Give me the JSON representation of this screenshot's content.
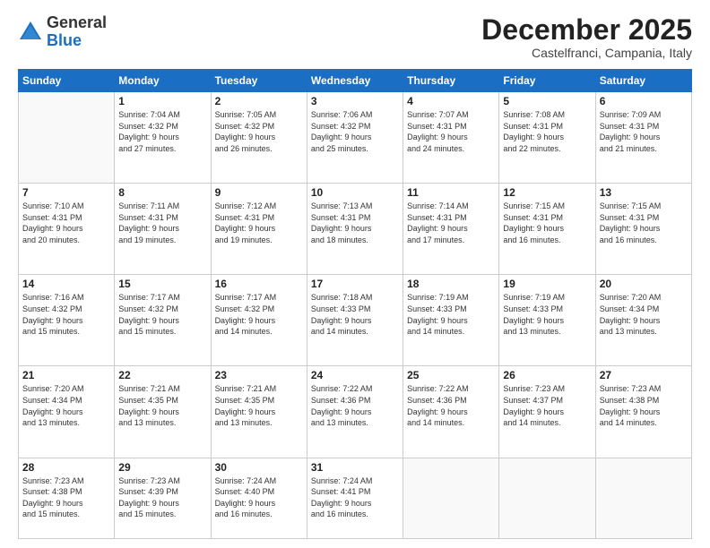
{
  "logo": {
    "general": "General",
    "blue": "Blue"
  },
  "header": {
    "month": "December 2025",
    "location": "Castelfranci, Campania, Italy"
  },
  "days_of_week": [
    "Sunday",
    "Monday",
    "Tuesday",
    "Wednesday",
    "Thursday",
    "Friday",
    "Saturday"
  ],
  "weeks": [
    [
      {
        "day": "",
        "info": ""
      },
      {
        "day": "1",
        "info": "Sunrise: 7:04 AM\nSunset: 4:32 PM\nDaylight: 9 hours\nand 27 minutes."
      },
      {
        "day": "2",
        "info": "Sunrise: 7:05 AM\nSunset: 4:32 PM\nDaylight: 9 hours\nand 26 minutes."
      },
      {
        "day": "3",
        "info": "Sunrise: 7:06 AM\nSunset: 4:32 PM\nDaylight: 9 hours\nand 25 minutes."
      },
      {
        "day": "4",
        "info": "Sunrise: 7:07 AM\nSunset: 4:31 PM\nDaylight: 9 hours\nand 24 minutes."
      },
      {
        "day": "5",
        "info": "Sunrise: 7:08 AM\nSunset: 4:31 PM\nDaylight: 9 hours\nand 22 minutes."
      },
      {
        "day": "6",
        "info": "Sunrise: 7:09 AM\nSunset: 4:31 PM\nDaylight: 9 hours\nand 21 minutes."
      }
    ],
    [
      {
        "day": "7",
        "info": "Sunrise: 7:10 AM\nSunset: 4:31 PM\nDaylight: 9 hours\nand 20 minutes."
      },
      {
        "day": "8",
        "info": "Sunrise: 7:11 AM\nSunset: 4:31 PM\nDaylight: 9 hours\nand 19 minutes."
      },
      {
        "day": "9",
        "info": "Sunrise: 7:12 AM\nSunset: 4:31 PM\nDaylight: 9 hours\nand 19 minutes."
      },
      {
        "day": "10",
        "info": "Sunrise: 7:13 AM\nSunset: 4:31 PM\nDaylight: 9 hours\nand 18 minutes."
      },
      {
        "day": "11",
        "info": "Sunrise: 7:14 AM\nSunset: 4:31 PM\nDaylight: 9 hours\nand 17 minutes."
      },
      {
        "day": "12",
        "info": "Sunrise: 7:15 AM\nSunset: 4:31 PM\nDaylight: 9 hours\nand 16 minutes."
      },
      {
        "day": "13",
        "info": "Sunrise: 7:15 AM\nSunset: 4:31 PM\nDaylight: 9 hours\nand 16 minutes."
      }
    ],
    [
      {
        "day": "14",
        "info": "Sunrise: 7:16 AM\nSunset: 4:32 PM\nDaylight: 9 hours\nand 15 minutes."
      },
      {
        "day": "15",
        "info": "Sunrise: 7:17 AM\nSunset: 4:32 PM\nDaylight: 9 hours\nand 15 minutes."
      },
      {
        "day": "16",
        "info": "Sunrise: 7:17 AM\nSunset: 4:32 PM\nDaylight: 9 hours\nand 14 minutes."
      },
      {
        "day": "17",
        "info": "Sunrise: 7:18 AM\nSunset: 4:33 PM\nDaylight: 9 hours\nand 14 minutes."
      },
      {
        "day": "18",
        "info": "Sunrise: 7:19 AM\nSunset: 4:33 PM\nDaylight: 9 hours\nand 14 minutes."
      },
      {
        "day": "19",
        "info": "Sunrise: 7:19 AM\nSunset: 4:33 PM\nDaylight: 9 hours\nand 13 minutes."
      },
      {
        "day": "20",
        "info": "Sunrise: 7:20 AM\nSunset: 4:34 PM\nDaylight: 9 hours\nand 13 minutes."
      }
    ],
    [
      {
        "day": "21",
        "info": "Sunrise: 7:20 AM\nSunset: 4:34 PM\nDaylight: 9 hours\nand 13 minutes."
      },
      {
        "day": "22",
        "info": "Sunrise: 7:21 AM\nSunset: 4:35 PM\nDaylight: 9 hours\nand 13 minutes."
      },
      {
        "day": "23",
        "info": "Sunrise: 7:21 AM\nSunset: 4:35 PM\nDaylight: 9 hours\nand 13 minutes."
      },
      {
        "day": "24",
        "info": "Sunrise: 7:22 AM\nSunset: 4:36 PM\nDaylight: 9 hours\nand 13 minutes."
      },
      {
        "day": "25",
        "info": "Sunrise: 7:22 AM\nSunset: 4:36 PM\nDaylight: 9 hours\nand 14 minutes."
      },
      {
        "day": "26",
        "info": "Sunrise: 7:23 AM\nSunset: 4:37 PM\nDaylight: 9 hours\nand 14 minutes."
      },
      {
        "day": "27",
        "info": "Sunrise: 7:23 AM\nSunset: 4:38 PM\nDaylight: 9 hours\nand 14 minutes."
      }
    ],
    [
      {
        "day": "28",
        "info": "Sunrise: 7:23 AM\nSunset: 4:38 PM\nDaylight: 9 hours\nand 15 minutes."
      },
      {
        "day": "29",
        "info": "Sunrise: 7:23 AM\nSunset: 4:39 PM\nDaylight: 9 hours\nand 15 minutes."
      },
      {
        "day": "30",
        "info": "Sunrise: 7:24 AM\nSunset: 4:40 PM\nDaylight: 9 hours\nand 16 minutes."
      },
      {
        "day": "31",
        "info": "Sunrise: 7:24 AM\nSunset: 4:41 PM\nDaylight: 9 hours\nand 16 minutes."
      },
      {
        "day": "",
        "info": ""
      },
      {
        "day": "",
        "info": ""
      },
      {
        "day": "",
        "info": ""
      }
    ]
  ]
}
